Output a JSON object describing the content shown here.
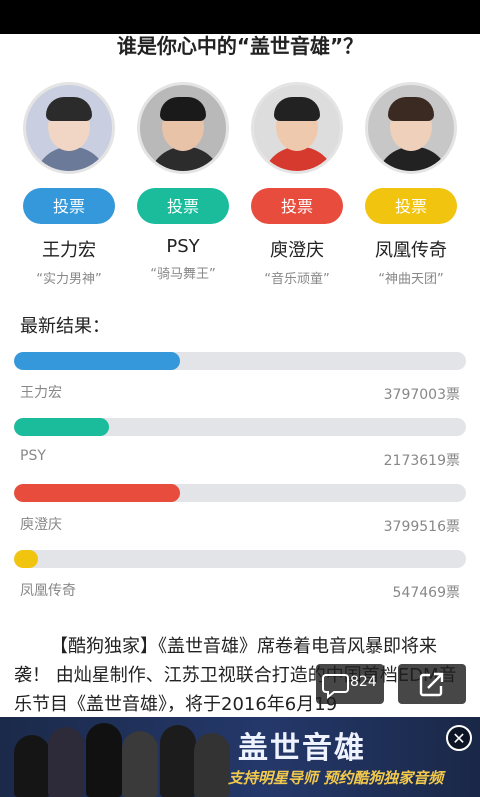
{
  "header": {
    "title": "谁是你心中的“盖世音雄”？"
  },
  "candidates": [
    {
      "name": "王力宏",
      "tag": "“实力男神”",
      "vote_label": "投票",
      "color": "#3498db"
    },
    {
      "name": "PSY",
      "tag": "“骑马舞王”",
      "vote_label": "投票",
      "color": "#1abc9c"
    },
    {
      "name": "庾澄庆",
      "tag": "“音乐顽童”",
      "vote_label": "投票",
      "color": "#e74c3c"
    },
    {
      "name": "凤凰传奇",
      "tag": "“神曲天团”",
      "vote_label": "投票",
      "color": "#f1c40f"
    }
  ],
  "results": {
    "title": "最新结果：",
    "rows": [
      {
        "name": "王力宏",
        "votes": "3797003票",
        "value": 3797003
      },
      {
        "name": "PSY",
        "votes": "2173619票",
        "value": 2173619
      },
      {
        "name": "庾澄庆",
        "votes": "3799516票",
        "value": 3799516
      },
      {
        "name": "凤凰传奇",
        "votes": "547469票",
        "value": 547469
      }
    ],
    "max": 10350000
  },
  "article": {
    "text": "【酷狗独家】《盖世音雄》席卷着电音风暴即将来袭！ 由灿星制作、江苏卫视联合打造的中国首档EDM音乐节目《盖世音雄》，将于2016年6月19"
  },
  "floating": {
    "comment_count": "824",
    "comment_icon": "comment-icon",
    "share_icon": "share-icon"
  },
  "banner": {
    "title": "盖世音雄",
    "subtitle": "支持明星导师 预约酷狗独家音频",
    "close_icon": "close-icon"
  }
}
